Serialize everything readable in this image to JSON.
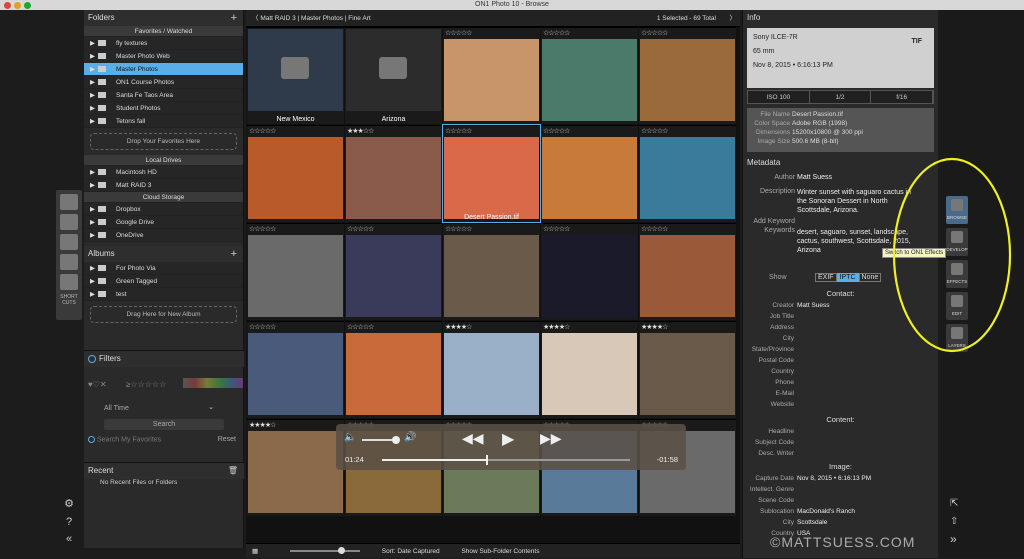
{
  "window": {
    "title": "ON1 Photo 10 - Browse"
  },
  "left_tools": {
    "shortcuts_label": "SHORT CUTS"
  },
  "folders": {
    "header": "Folders",
    "favorites_section": "Favorites / Watched",
    "favorites": [
      "fly textures",
      "Master Photo Web",
      "Master Photos",
      "ON1 Course Photos",
      "Santa Fe Taos Area",
      "Student Photos",
      "Tetons fall"
    ],
    "selected": "Master Photos",
    "drop_favorites": "Drop Your Favorites Here",
    "local_section": "Local Drives",
    "local": [
      "Macintosh HD",
      "Matt RAID 3"
    ],
    "cloud_section": "Cloud Storage",
    "cloud": [
      "Dropbox",
      "Google Drive",
      "OneDrive"
    ]
  },
  "albums": {
    "header": "Albums",
    "items": [
      "For Photo Via",
      "Green Tagged",
      "test"
    ],
    "drop": "Drag Here for New Album"
  },
  "filters": {
    "header": "Filters",
    "date": "All Time",
    "search_btn": "Search",
    "search_fav": "Search My Favorites",
    "reset": "Reset"
  },
  "recent": {
    "header": "Recent",
    "empty": "No Recent Files or Folders"
  },
  "browser": {
    "breadcrumb": [
      "Matt RAID 3",
      "Master Photos",
      "Fine Art"
    ],
    "selection": "1 Selected - 69 Total",
    "sort": "Sort: Date Captured",
    "subfolders": "Show Sub-Folder Contents",
    "cells": [
      {
        "caption": "New Mexico",
        "folder": true,
        "stars": "",
        "color": "#2f3b4a"
      },
      {
        "caption": "Arizona",
        "folder": true,
        "stars": "",
        "color": "#2c2c2c"
      },
      {
        "caption": "",
        "stars": "☆☆☆☆☆",
        "color": "#c8956a"
      },
      {
        "caption": "",
        "stars": "☆☆☆☆☆",
        "color": "#4a7a6a"
      },
      {
        "caption": "",
        "stars": "☆☆☆☆☆",
        "color": "#9a6a3a"
      },
      {
        "caption": "",
        "stars": "☆☆☆☆☆",
        "color": "#b85a2a"
      },
      {
        "caption": "",
        "stars": "★★★☆☆",
        "color": "#8a5a4a"
      },
      {
        "caption": "Desert Passion.tif",
        "stars": "☆☆☆☆☆",
        "color": "#d86a4a"
      },
      {
        "caption": "",
        "stars": "☆☆☆☆☆",
        "color": "#c87a3a"
      },
      {
        "caption": "",
        "stars": "☆☆☆☆☆",
        "color": "#3a7a9a"
      },
      {
        "caption": "",
        "stars": "☆☆☆☆☆",
        "color": "#6a6a6a"
      },
      {
        "caption": "",
        "stars": "☆☆☆☆☆",
        "color": "#3a3a5a"
      },
      {
        "caption": "",
        "stars": "☆☆☆☆☆",
        "color": "#6a5a4a"
      },
      {
        "caption": "",
        "stars": "☆☆☆☆☆",
        "color": "#1a1a2a"
      },
      {
        "caption": "",
        "stars": "☆☆☆☆☆",
        "color": "#9a5a3a"
      },
      {
        "caption": "",
        "stars": "☆☆☆☆☆",
        "color": "#4a5a7a"
      },
      {
        "caption": "",
        "stars": "☆☆☆☆☆",
        "color": "#c86a3a"
      },
      {
        "caption": "",
        "stars": "★★★★☆",
        "color": "#9ab0c8"
      },
      {
        "caption": "",
        "stars": "★★★★☆",
        "color": "#d8c8b8"
      },
      {
        "caption": "",
        "stars": "★★★★☆",
        "color": "#6a5a4a"
      },
      {
        "caption": "",
        "stars": "★★★★☆",
        "color": "#8a6a4a"
      },
      {
        "caption": "",
        "stars": "☆☆☆☆☆",
        "color": "#8a6a3a"
      },
      {
        "caption": "",
        "stars": "☆☆☆☆☆",
        "color": "#6a7a5a"
      },
      {
        "caption": "",
        "stars": "☆☆☆☆☆",
        "color": "#5a7a9a"
      },
      {
        "caption": "",
        "stars": "☆☆☆☆☆",
        "color": "#6a6a6a"
      }
    ]
  },
  "player": {
    "elapsed": "01:24",
    "remaining": "-01:58",
    "progress": 0.42
  },
  "info": {
    "header": "Info",
    "camera": "Sony ILCE-7R",
    "lens": "65 mm",
    "date": "Nov 8, 2015 • 6:16:13 PM",
    "format": "TIF",
    "exposure": [
      "ISO 100",
      "1/2",
      "f/16"
    ],
    "file": [
      {
        "label": "File Name",
        "value": "Desert Passion.tif"
      },
      {
        "label": "Color Space",
        "value": "Adobe RGB (1998)"
      },
      {
        "label": "Dimensions",
        "value": "15200x10800 @ 300 ppi"
      },
      {
        "label": "Image Size",
        "value": "500.6 MB (8-bit)"
      }
    ]
  },
  "metadata": {
    "header": "Metadata",
    "author_label": "Author",
    "author": "Matt Suess",
    "description_label": "Description",
    "description": [
      "Winter sunset with saguaro cactus in",
      "the Sonoran Dessert in North",
      "Scottsdale, Arizona."
    ],
    "keywords_label": "Add Keyword",
    "keywords_label2": "Keywords",
    "keywords": [
      "desert, saguaro, sunset, landscape,",
      "cactus, southwest, Scottsdale, 2015,",
      "Arizona"
    ],
    "show_label": "Show",
    "show_options": [
      "EXIF",
      "IPTC",
      "None"
    ],
    "show_selected": "IPTC",
    "contact_header": "Contact:",
    "contact": [
      {
        "label": "Creator",
        "value": "Matt Suess"
      },
      {
        "label": "Job Title",
        "value": ""
      },
      {
        "label": "Address",
        "value": ""
      },
      {
        "label": "City",
        "value": ""
      },
      {
        "label": "State/Province",
        "value": ""
      },
      {
        "label": "Postal Code",
        "value": ""
      },
      {
        "label": "Country",
        "value": ""
      },
      {
        "label": "Phone",
        "value": ""
      },
      {
        "label": "E-Mail",
        "value": ""
      },
      {
        "label": "Website",
        "value": ""
      }
    ],
    "content_header": "Content:",
    "content": [
      {
        "label": "Headline",
        "value": ""
      },
      {
        "label": "Subject Code",
        "value": ""
      },
      {
        "label": "Desc. Writer",
        "value": ""
      }
    ],
    "image_header": "Image:",
    "image": [
      {
        "label": "Capture Date",
        "value": "Nov 8, 2015 • 6:16:13 PM"
      },
      {
        "label": "Intellect. Genre",
        "value": ""
      },
      {
        "label": "Scene Code",
        "value": ""
      },
      {
        "label": "Sublocation",
        "value": "MacDonald's Ranch"
      },
      {
        "label": "City",
        "value": "Scottsdale"
      },
      {
        "label": "Country",
        "value": "USA"
      }
    ]
  },
  "modules": {
    "browse": "BROWSE",
    "develop": "DEVELOP",
    "effects": "EFFECTS",
    "edit": "EDIT",
    "layers": "LAYERS",
    "tooltip": "Switch to ON1 Effects"
  },
  "watermark": "©MATTSUESS.COM",
  "colors": {
    "accent": "#5aaee8",
    "annotation": "#f0f020"
  }
}
